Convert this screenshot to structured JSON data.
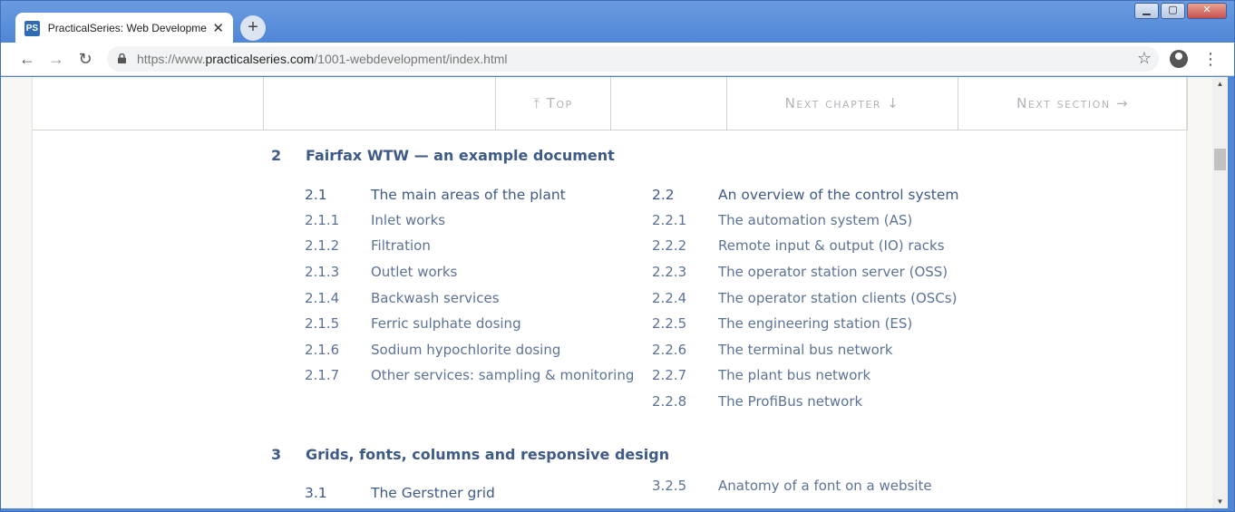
{
  "browser": {
    "tab_title": "PracticalSeries: Web Developmen",
    "tab_favicon_text": "PS",
    "new_tab_label": "+",
    "url_prefix": "https://www.",
    "url_host": "practicalseries.com",
    "url_path": "/1001-webdevelopment/index.html",
    "window_controls": {
      "minimize": "▁",
      "maximize": "▢",
      "close": "✕"
    }
  },
  "icons": [
    "back-icon",
    "forward-icon",
    "reload-icon",
    "lock-icon",
    "star-icon",
    "profile-icon",
    "menu-icon"
  ],
  "topnav": {
    "top": "⤒ Top",
    "next_chapter": "Next chapter ↓",
    "next_section": "Next section →"
  },
  "chapters": [
    {
      "number": "2",
      "title": "Fairfax WTW — an example document",
      "left": [
        {
          "num": "2.1",
          "label": "The main areas of the plant"
        },
        {
          "num": "2.1.1",
          "label": "Inlet works"
        },
        {
          "num": "2.1.2",
          "label": "Filtration"
        },
        {
          "num": "2.1.3",
          "label": "Outlet works"
        },
        {
          "num": "2.1.4",
          "label": "Backwash services"
        },
        {
          "num": "2.1.5",
          "label": "Ferric sulphate dosing"
        },
        {
          "num": "2.1.6",
          "label": "Sodium hypochlorite dosing"
        },
        {
          "num": "2.1.7",
          "label": "Other services: sampling & monitoring"
        }
      ],
      "right": [
        {
          "num": "2.2",
          "label": "An overview of the control system"
        },
        {
          "num": "2.2.1",
          "label": "The automation system (AS)"
        },
        {
          "num": "2.2.2",
          "label": "Remote input & output (IO) racks"
        },
        {
          "num": "2.2.3",
          "label": "The operator station server (OSS)"
        },
        {
          "num": "2.2.4",
          "label": "The operator station clients (OSCs)"
        },
        {
          "num": "2.2.5",
          "label": "The engineering station (ES)"
        },
        {
          "num": "2.2.6",
          "label": "The terminal bus network"
        },
        {
          "num": "2.2.7",
          "label": "The plant bus network"
        },
        {
          "num": "2.2.8",
          "label": "The ProfiBus network"
        }
      ]
    },
    {
      "number": "3",
      "title": "Grids, fonts, columns and responsive design",
      "left": [
        {
          "num": "3.1",
          "label": "The Gerstner grid"
        }
      ],
      "right": [
        {
          "num": "3.2.5",
          "label": "Anatomy of a font on a website"
        }
      ]
    }
  ],
  "colors": {
    "heading": "#3e5a86",
    "entry": "#5c7396",
    "nav_text": "#b0b3b9",
    "page_bg": "#f8f7f4"
  }
}
